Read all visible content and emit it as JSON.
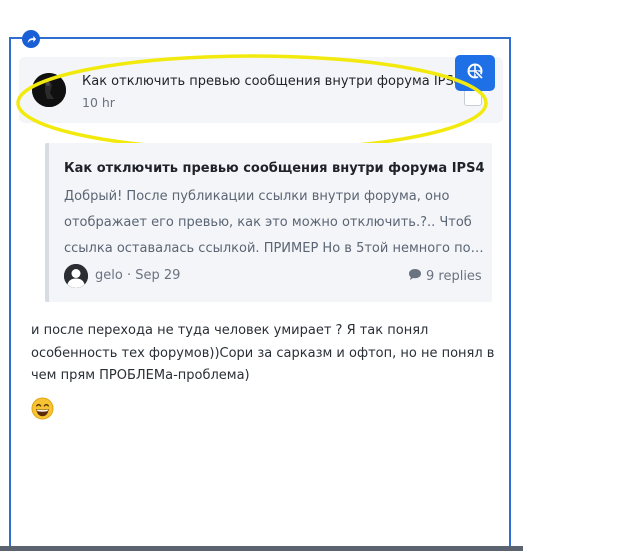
{
  "topic": {
    "title": "Как отключить превью сообщения внутри форума IPS4",
    "time": "10 hr"
  },
  "onebox": {
    "title": "Как отключить превью сообщения внутри форума IPS4",
    "excerpt": "Добрый! После публикации ссылки внутри форума, оно отображает его превью, как это можно отключить.?.. Чтоб ссылка оставалась ссылкой. ПРИМЕР Но в 5той немного по…",
    "meta": "gelo · Sep 29",
    "replies": "9 replies"
  },
  "post": {
    "body": "и после перехода не туда человек умирает ? Я так понял особенность тех форумов))Сори за сарказм и офтоп, но не понял в чем прям ПРОБЛЕМа-проблема)"
  },
  "icons": {
    "frame_handle": "share-arrow-icon",
    "launch_button": "launch-icon",
    "replies": "comment-icon",
    "emoji": "grinning-smiling-eyes-emoji"
  },
  "colors": {
    "frame_border": "#2f6fcf",
    "launch_button": "#1f6fe6",
    "highlight": "#f2ea0d",
    "card_bg": "#f3f5f9"
  }
}
